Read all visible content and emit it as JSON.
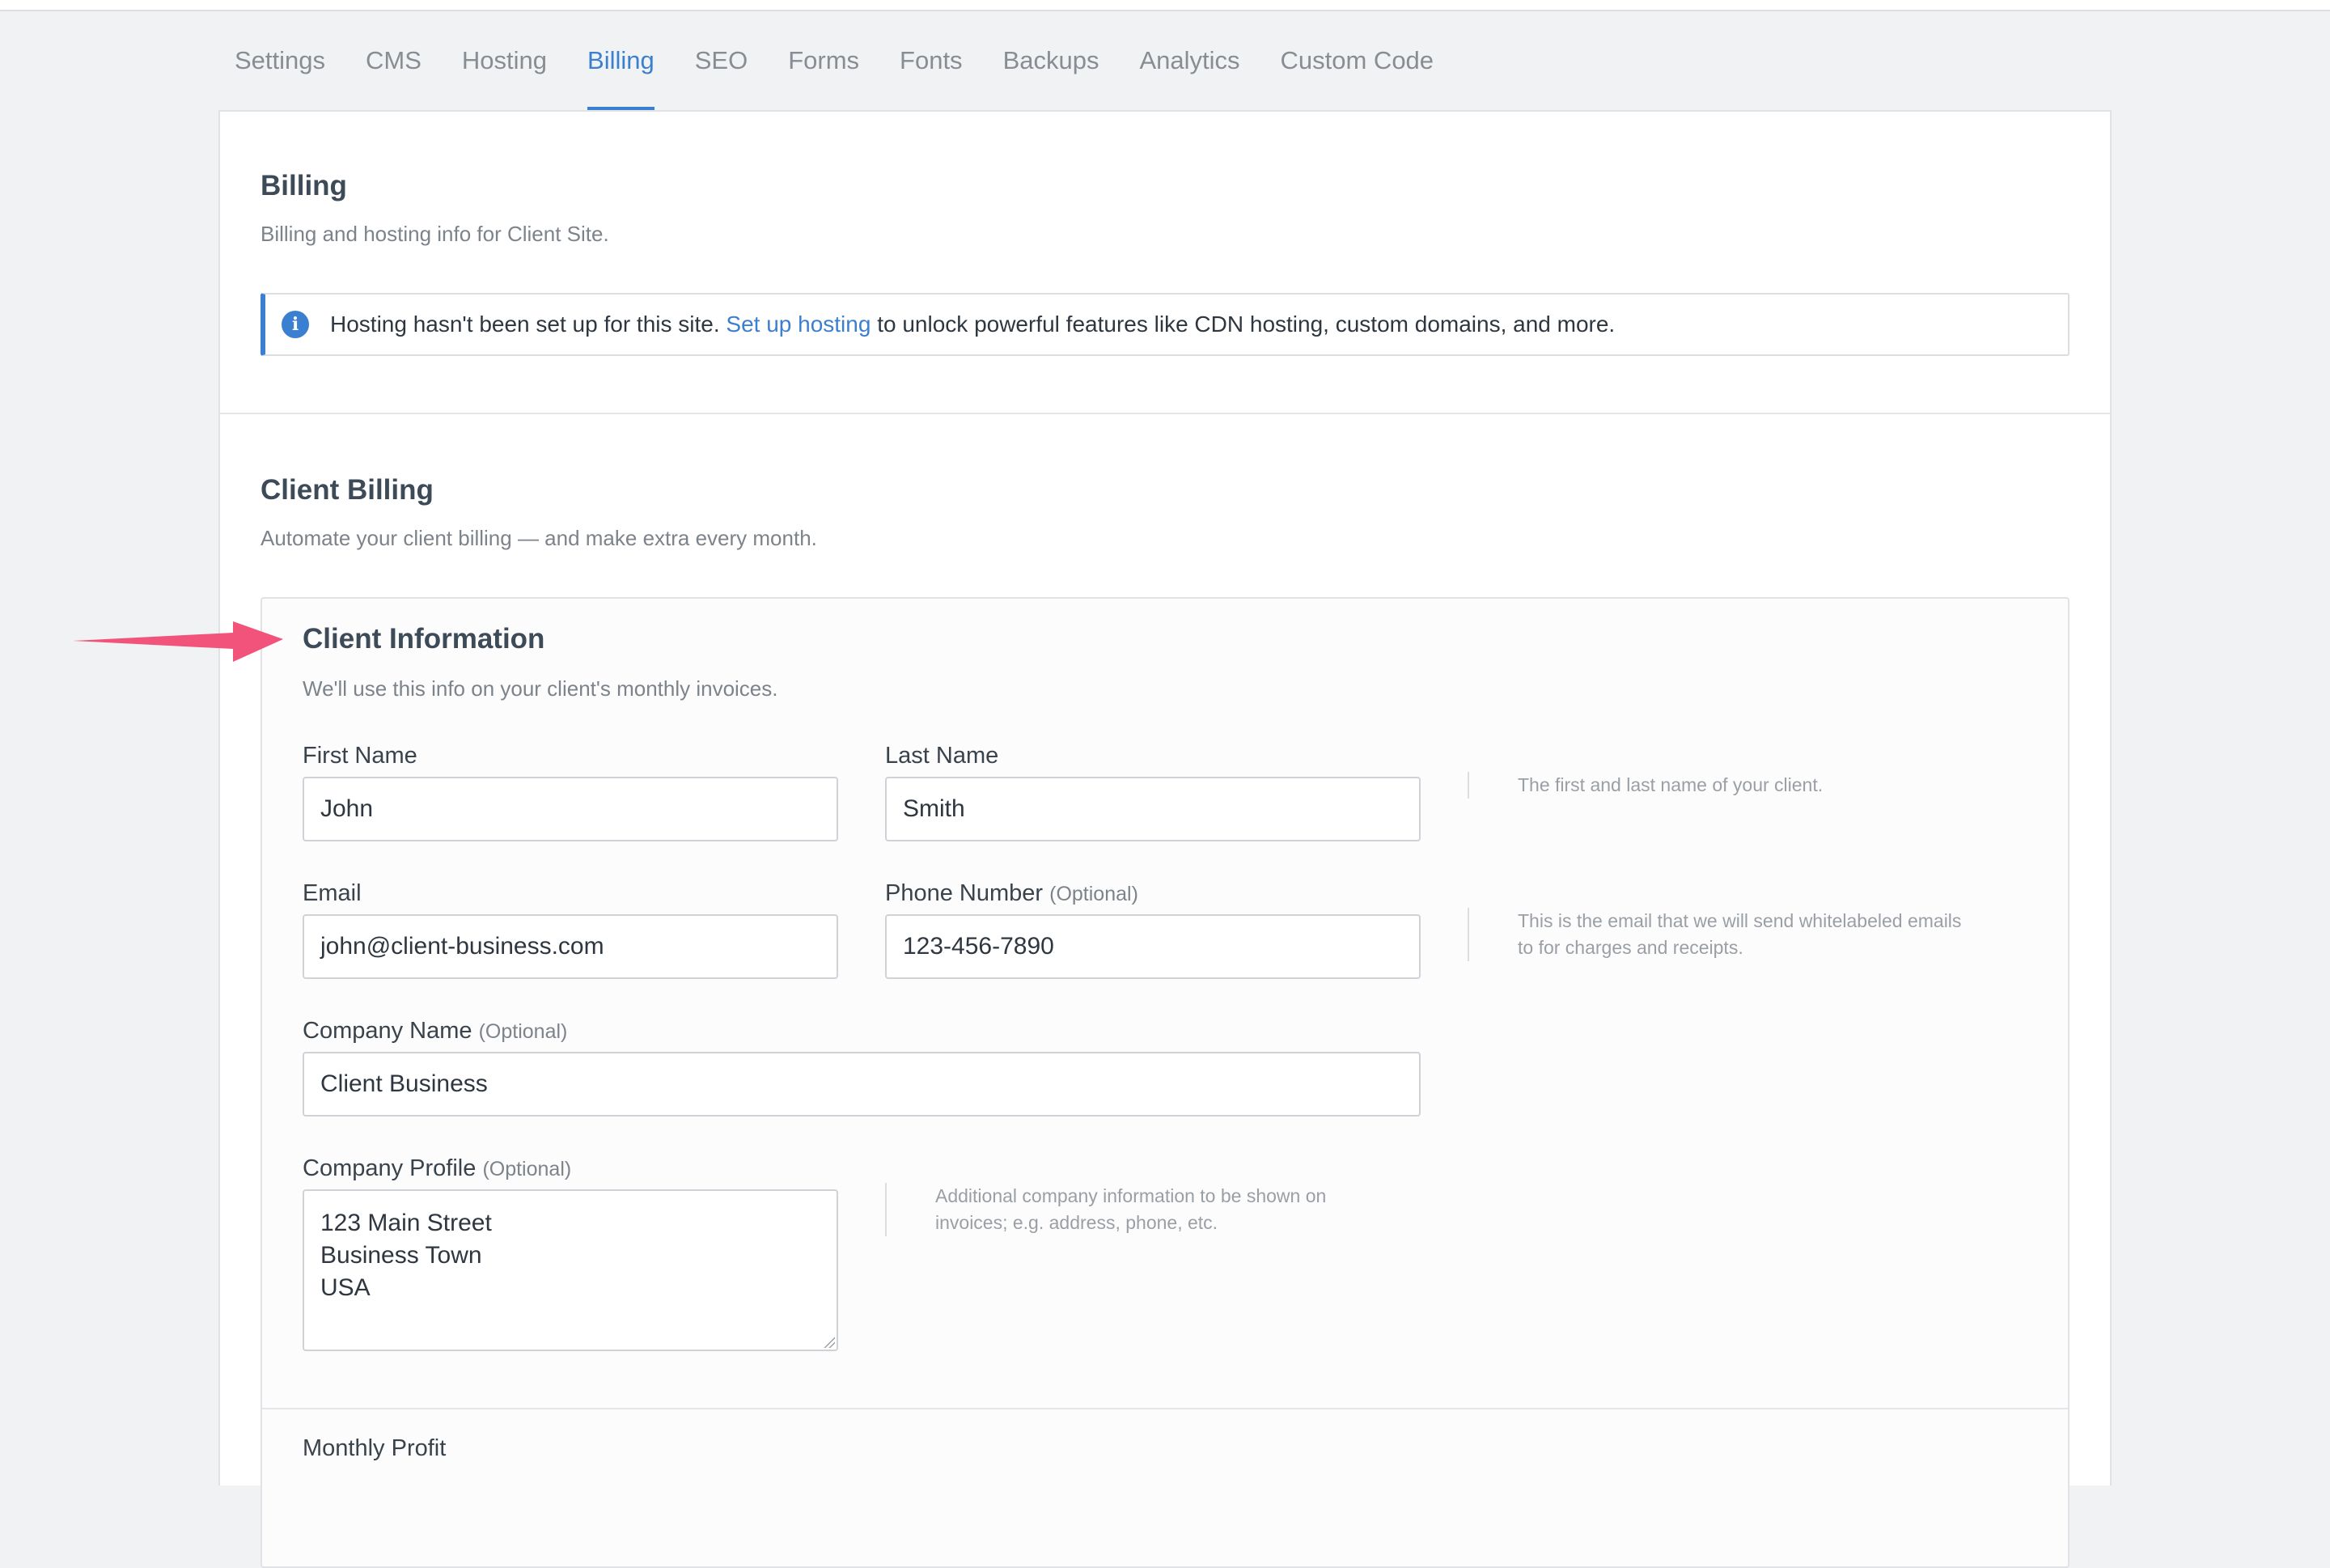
{
  "tabs": [
    "Settings",
    "CMS",
    "Hosting",
    "Billing",
    "SEO",
    "Forms",
    "Fonts",
    "Backups",
    "Analytics",
    "Custom Code"
  ],
  "active_tab": "Billing",
  "billing": {
    "title": "Billing",
    "subtitle": "Billing and hosting info for Client Site.",
    "alert_text_before": "Hosting hasn't been set up for this site.",
    "alert_link": "Set up hosting",
    "alert_text_after": "to unlock powerful features like CDN hosting, custom domains, and more."
  },
  "client_billing": {
    "title": "Client Billing",
    "subtitle": "Automate your client billing — and make extra every month."
  },
  "client_info": {
    "title": "Client Information",
    "subtitle": "We'll use this info on your client's monthly invoices.",
    "first_name_label": "First Name",
    "first_name_value": "John",
    "last_name_label": "Last Name",
    "last_name_value": "Smith",
    "name_hint": "The first and last name of your client.",
    "email_label": "Email",
    "email_value": "john@client-business.com",
    "phone_label": "Phone Number",
    "phone_optional": "(Optional)",
    "phone_value": "123-456-7890",
    "email_hint_line1": "This is the email that we will send whitelabeled emails",
    "email_hint_line2": "to for charges and receipts.",
    "company_name_label": "Company Name",
    "company_name_optional": "(Optional)",
    "company_name_value": "Client Business",
    "company_profile_label": "Company Profile",
    "company_profile_optional": "(Optional)",
    "company_profile_lines": [
      "123 Main Street",
      "Business Town",
      "USA"
    ],
    "profile_hint_line1": "Additional company information to be shown on",
    "profile_hint_line2": "invoices; e.g. address, phone, etc.",
    "monthly_profit_label": "Monthly Profit"
  },
  "colors": {
    "accent": "#3b7fd0",
    "arrow": "#f2537a"
  }
}
